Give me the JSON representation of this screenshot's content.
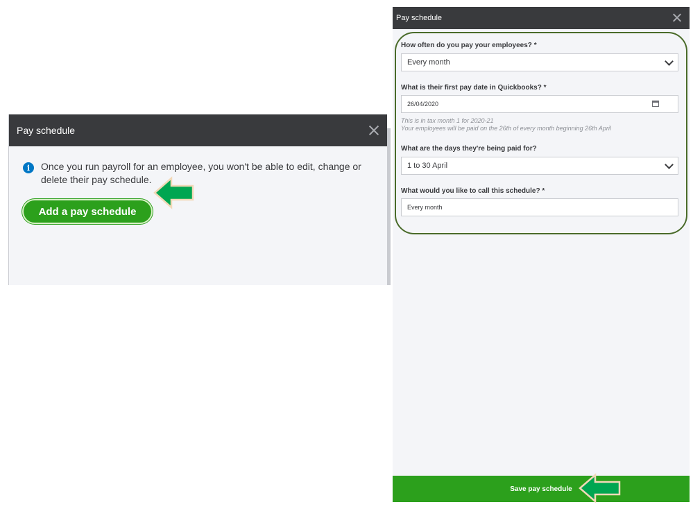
{
  "left_dialog": {
    "title": "Pay schedule",
    "info_text": "Once you run payroll for an employee, you won't be able to edit, change or delete their pay schedule.",
    "add_button": "Add a pay schedule"
  },
  "right_panel": {
    "title": "Pay schedule",
    "frequency": {
      "label": "How often do you pay your employees? *",
      "value": "Every month"
    },
    "first_pay_date": {
      "label": "What is their first pay date in Quickbooks? *",
      "value": "26/04/2020"
    },
    "hint_line1": "This is in tax month 1 for 2020-21",
    "hint_line2": "Your employees will be paid on the 26th of every month beginning 26th April",
    "pay_period": {
      "label": "What are the days they're being paid for?",
      "value": "1 to 30 April"
    },
    "schedule_name": {
      "label": "What would you like to call this schedule? *",
      "value": "Every month"
    },
    "save_button": "Save pay schedule"
  },
  "colors": {
    "accent_green": "#2ca01c",
    "titlebar": "#393a3d",
    "highlight_border": "#4a6b2a",
    "info_blue": "#0077c5"
  }
}
